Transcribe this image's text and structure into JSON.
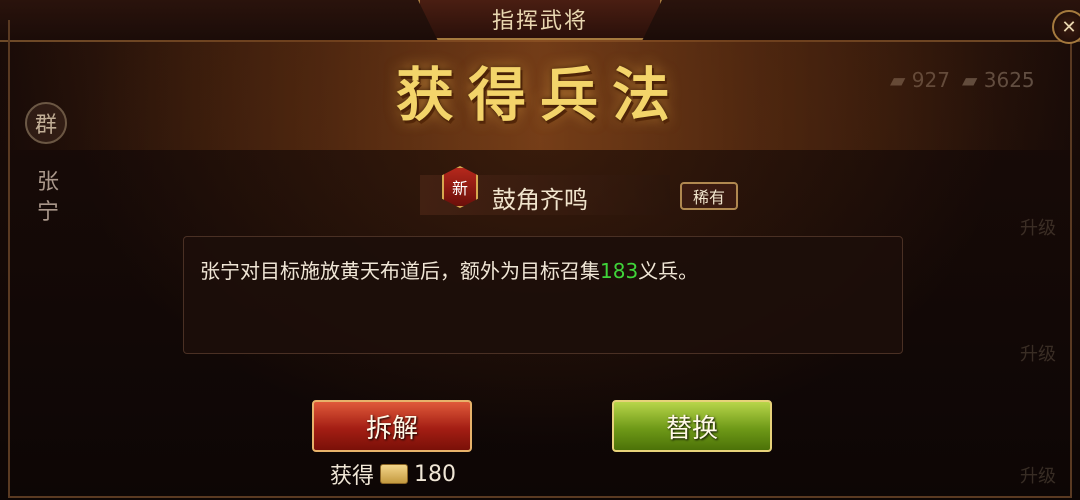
{
  "header": {
    "title": "指挥武将",
    "close_icon": "close-icon"
  },
  "side": {
    "faction": "群",
    "hero_name": "张宁"
  },
  "resources": [
    {
      "icon": "scroll-icon",
      "value": "927"
    },
    {
      "icon": "hand-icon",
      "value": "3625"
    }
  ],
  "banner": {
    "title": "获得兵法"
  },
  "skill": {
    "new_label": "新",
    "name": "鼓角齐鸣",
    "rarity": "稀有"
  },
  "description": {
    "prefix": "张宁对目标施放黄天布道后，额外为目标召集",
    "number": "183",
    "suffix": "义兵。"
  },
  "background_text": {
    "upgrade_label": "升级"
  },
  "actions": {
    "decompose": "拆解",
    "replace": "替换"
  },
  "gain": {
    "label": "获得",
    "icon": "scroll-token-icon",
    "value": "180"
  },
  "colors": {
    "highlight_number": "#3fd43a",
    "title_gold": "#f3d46a"
  }
}
